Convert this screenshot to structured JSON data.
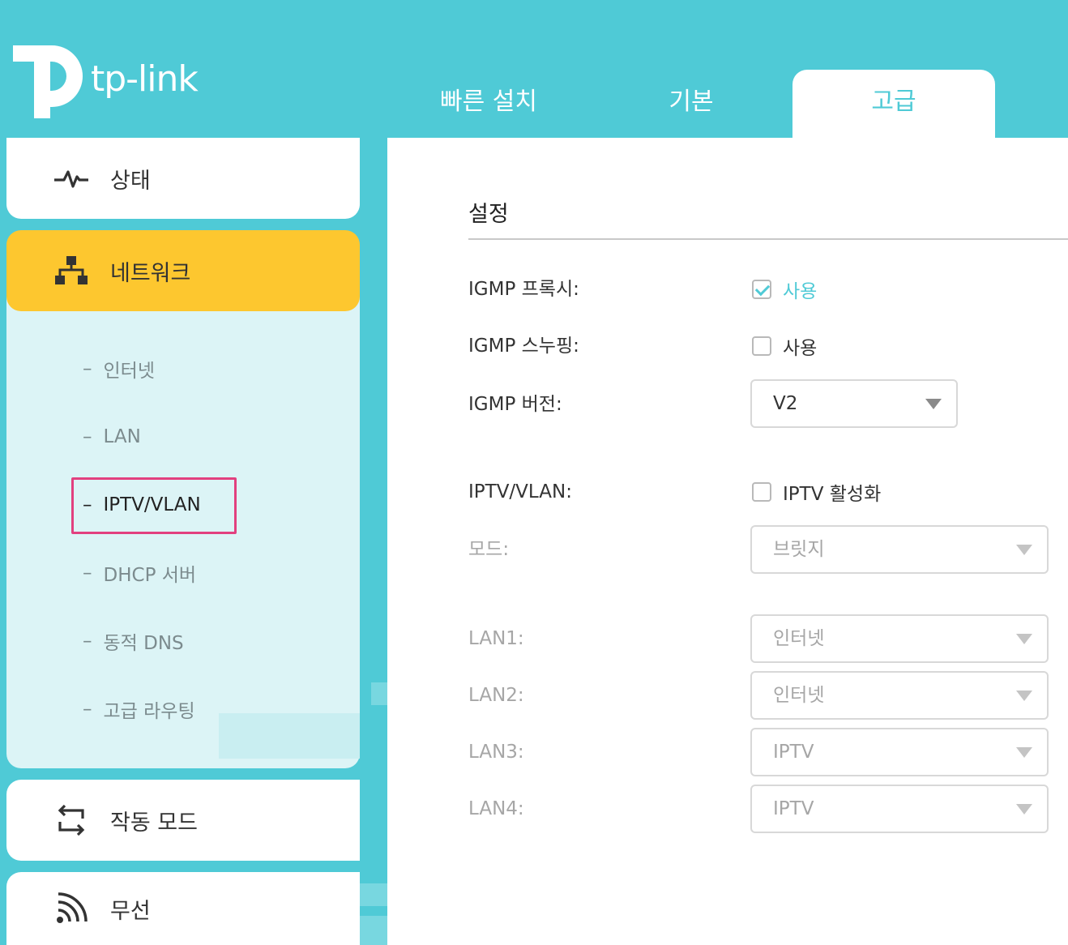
{
  "brand": {
    "name": "tp-link",
    "accent_color": "#4fcad6",
    "highlight_color": "#fdc72f"
  },
  "tabs": [
    {
      "label": "빠른 설치"
    },
    {
      "label": "기본"
    },
    {
      "label": "고급",
      "active": true
    }
  ],
  "sidebar": {
    "status": {
      "label": "상태",
      "icon": "pulse-icon"
    },
    "network": {
      "label": "네트워크",
      "icon": "network-icon",
      "items": [
        {
          "label": "인터넷"
        },
        {
          "label": "LAN"
        },
        {
          "label": "IPTV/VLAN",
          "active": true
        },
        {
          "label": "DHCP 서버"
        },
        {
          "label": "동적 DNS"
        },
        {
          "label": "고급 라우팅"
        }
      ]
    },
    "opmode": {
      "label": "작동 모드",
      "icon": "switch-arrows-icon"
    },
    "wireless": {
      "label": "무선",
      "icon": "wifi-icon"
    }
  },
  "settings": {
    "title": "설정",
    "igmp_proxy": {
      "label": "IGMP 프록시:",
      "option": "사용",
      "checked": true
    },
    "igmp_snooping": {
      "label": "IGMP 스누핑:",
      "option": "사용",
      "checked": false
    },
    "igmp_version": {
      "label": "IGMP 버전:",
      "value": "V2"
    },
    "iptv_vlan": {
      "label": "IPTV/VLAN:",
      "option": "IPTV 활성화",
      "checked": false
    },
    "mode": {
      "label": "모드:",
      "value": "브릿지"
    },
    "lan1": {
      "label": "LAN1:",
      "value": "인터넷"
    },
    "lan2": {
      "label": "LAN2:",
      "value": "인터넷"
    },
    "lan3": {
      "label": "LAN3:",
      "value": "IPTV"
    },
    "lan4": {
      "label": "LAN4:",
      "value": "IPTV"
    }
  }
}
